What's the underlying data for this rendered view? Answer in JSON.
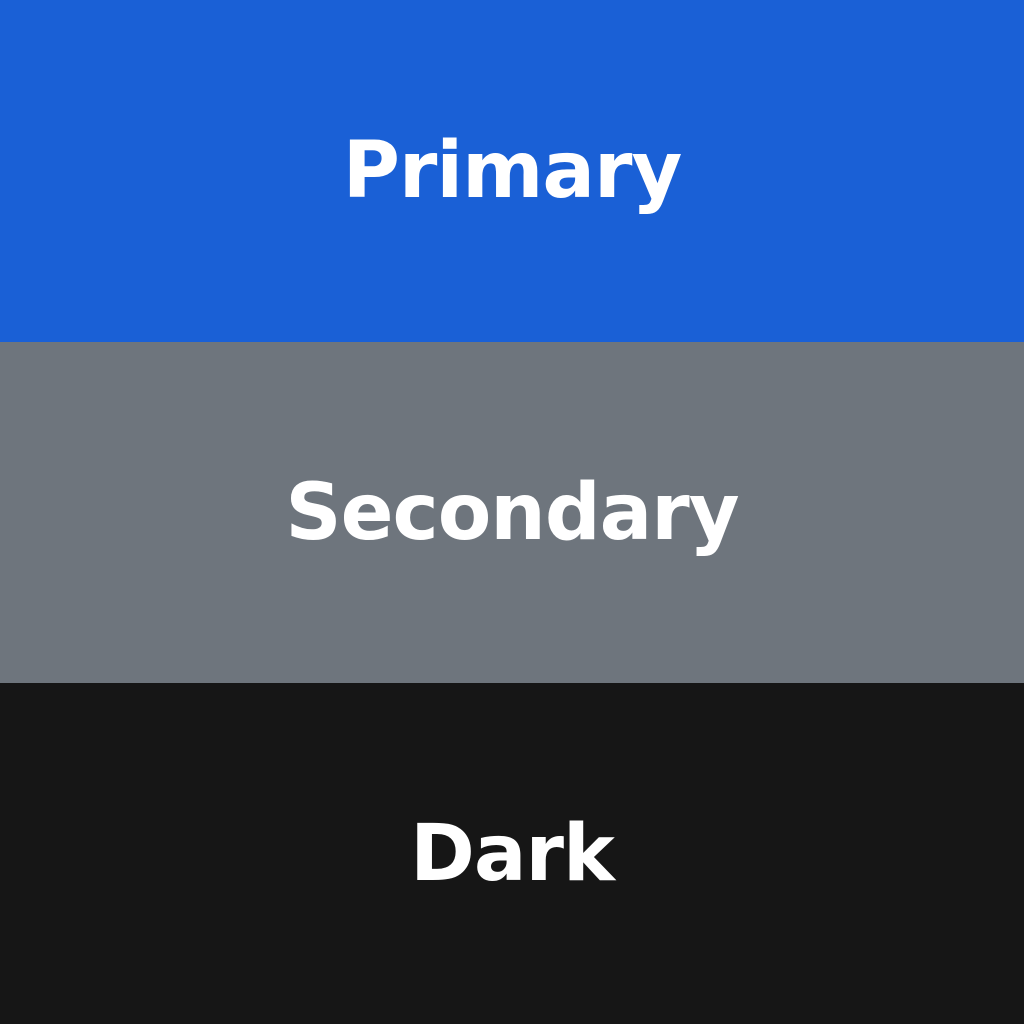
{
  "swatches": [
    {
      "label": "Primary",
      "color": "#1A60D6"
    },
    {
      "label": "Secondary",
      "color": "#6E757D"
    },
    {
      "label": "Dark",
      "color": "#161616"
    }
  ],
  "text_color": "#FFFFFF"
}
